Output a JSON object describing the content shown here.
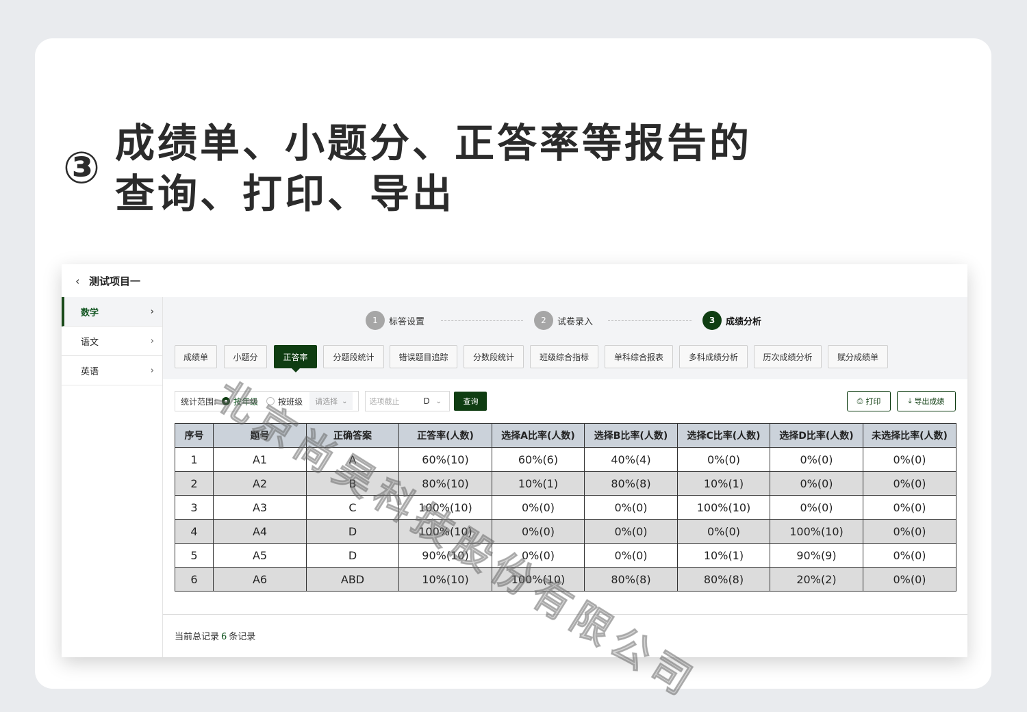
{
  "headline": {
    "number": "③",
    "text": "成绩单、小题分、正答率等报告的查询、打印、导出"
  },
  "topbar": {
    "back_icon": "chevron-left-icon",
    "project_title": "测试项目一"
  },
  "sidebar": {
    "items": [
      {
        "label": "数学",
        "active": true
      },
      {
        "label": "语文",
        "active": false
      },
      {
        "label": "英语",
        "active": false
      }
    ]
  },
  "steps": [
    {
      "num": "1",
      "label": "标答设置"
    },
    {
      "num": "2",
      "label": "试卷录入"
    },
    {
      "num": "3",
      "label": "成绩分析",
      "current": true
    }
  ],
  "tabs": [
    "成绩单",
    "小题分",
    "正答率",
    "分题段统计",
    "错误题目追踪",
    "分数段统计",
    "班级综合指标",
    "单科综合报表",
    "多科成绩分析",
    "历次成绩分析",
    "赋分成绩单"
  ],
  "active_tab": "正答率",
  "filter": {
    "scope_label": "统计范围:",
    "option_grade": "按年级",
    "option_class": "按班级",
    "selected": "按年级",
    "select_placeholder": "请选择",
    "cutoff_placeholder": "选项截止",
    "cutoff_value": "D",
    "query_label": "查询"
  },
  "actions": {
    "print_label": "打印",
    "export_label": "导出成绩"
  },
  "table": {
    "columns": [
      "序号",
      "题号",
      "正确答案",
      "正答率(人数)",
      "选择A比率(人数)",
      "选择B比率(人数)",
      "选择C比率(人数)",
      "选择D比率(人数)",
      "未选择比率(人数)"
    ],
    "rows": [
      [
        "1",
        "A1",
        "A",
        "60%(10)",
        "60%(6)",
        "40%(4)",
        "0%(0)",
        "0%(0)",
        "0%(0)"
      ],
      [
        "2",
        "A2",
        "B",
        "80%(10)",
        "10%(1)",
        "80%(8)",
        "10%(1)",
        "0%(0)",
        "0%(0)"
      ],
      [
        "3",
        "A3",
        "C",
        "100%(10)",
        "0%(0)",
        "0%(0)",
        "100%(10)",
        "0%(0)",
        "0%(0)"
      ],
      [
        "4",
        "A4",
        "D",
        "100%(10)",
        "0%(0)",
        "0%(0)",
        "0%(0)",
        "100%(10)",
        "0%(0)"
      ],
      [
        "5",
        "A5",
        "D",
        "90%(10)",
        "0%(0)",
        "0%(0)",
        "10%(1)",
        "90%(9)",
        "0%(0)"
      ],
      [
        "6",
        "A6",
        "ABD",
        "10%(10)",
        "100%(10)",
        "80%(8)",
        "80%(8)",
        "20%(2)",
        "0%(0)"
      ]
    ]
  },
  "footer": {
    "prefix": "当前总记录",
    "count": "6",
    "suffix": "条记录"
  },
  "watermark": "北京尚昊科技股份有限公司",
  "colors": {
    "accent": "#0f3d12",
    "header_bg": "#cbd2da",
    "alt_row": "#dcdcdc"
  }
}
